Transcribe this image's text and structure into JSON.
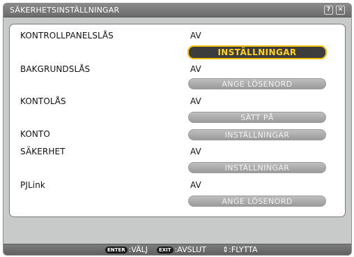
{
  "window": {
    "title": "SÄKERHETSINSTÄLLNINGAR",
    "help_icon": "?",
    "close_icon": "✕"
  },
  "rows": [
    {
      "label": "KONTROLLPANELSLÅS",
      "value": "AV",
      "button": "INSTÄLLNINGAR",
      "active": true
    },
    {
      "label": "BAKGRUNDSLÅS",
      "value": "AV",
      "button": "ANGE LÖSENORD",
      "active": false
    },
    {
      "label": "KONTOLÅS",
      "value": "AV",
      "button": "SÄTT PÅ",
      "active": false
    },
    {
      "label": "KONTO",
      "value": "",
      "button": "INSTÄLLNINGAR",
      "active": false
    },
    {
      "label": "SÄKERHET",
      "value": "AV",
      "button": "INSTÄLLNINGAR",
      "active": false
    },
    {
      "label": "PJLink",
      "value": "AV",
      "button": "ANGE LÖSENORD",
      "active": false
    }
  ],
  "footer": {
    "enter_key": "ENTER",
    "enter_text": ":VÄLJ",
    "exit_key": "EXIT",
    "exit_text": ":AVSLUT",
    "move_icon": "⇕",
    "move_text": ":FLYTTA"
  },
  "colors": {
    "highlight_text": "#ffd21c",
    "highlight_border": "#f0c010"
  }
}
